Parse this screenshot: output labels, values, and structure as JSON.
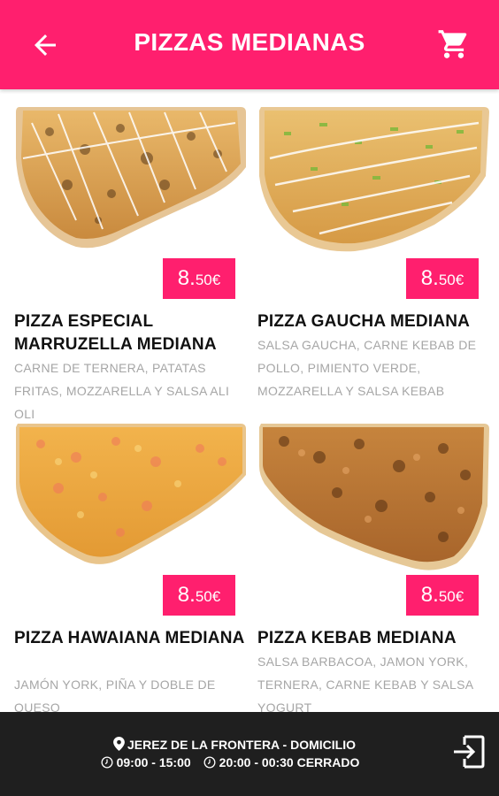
{
  "header": {
    "title": "PIZZAS MEDIANAS",
    "back_icon": "arrow-left-icon",
    "cart_icon": "shopping-cart-icon",
    "background_color": "#ff1f6e"
  },
  "products": [
    {
      "name": "PIZZA ESPECIAL MARRUZELLA MEDIANA",
      "price_int": "8.",
      "price_dec": "50€",
      "description": "CARNE DE TERNERA, PATATAS FRITAS, MOZZARELLA Y SALSA ALI OLI"
    },
    {
      "name": "PIZZA GAUCHA MEDIANA",
      "price_int": "8.",
      "price_dec": "50€",
      "description": "SALSA GAUCHA, CARNE KEBAB DE POLLO, PIMIENTO VERDE, MOZZARELLA Y SALSA KEBAB"
    },
    {
      "name": "PIZZA HAWAIANA MEDIANA",
      "price_int": "8.",
      "price_dec": "50€",
      "description": "JAMÓN YORK, PIÑA Y DOBLE DE QUESO"
    },
    {
      "name": "PIZZA KEBAB MEDIANA",
      "price_int": "8.",
      "price_dec": "50€",
      "description": "SALSA BARBACOA, JAMON YORK, TERNERA, CARNE KEBAB Y SALSA YOGURT"
    }
  ],
  "footer": {
    "location": "JEREZ DE LA FRONTERA - DOMICILIO",
    "hours_1": "09:00 - 15:00",
    "hours_2": "20:00 - 00:30",
    "status": "CERRADO",
    "location_icon": "map-pin-icon",
    "clock_icon": "clock-icon",
    "exit_icon": "exit-icon"
  }
}
